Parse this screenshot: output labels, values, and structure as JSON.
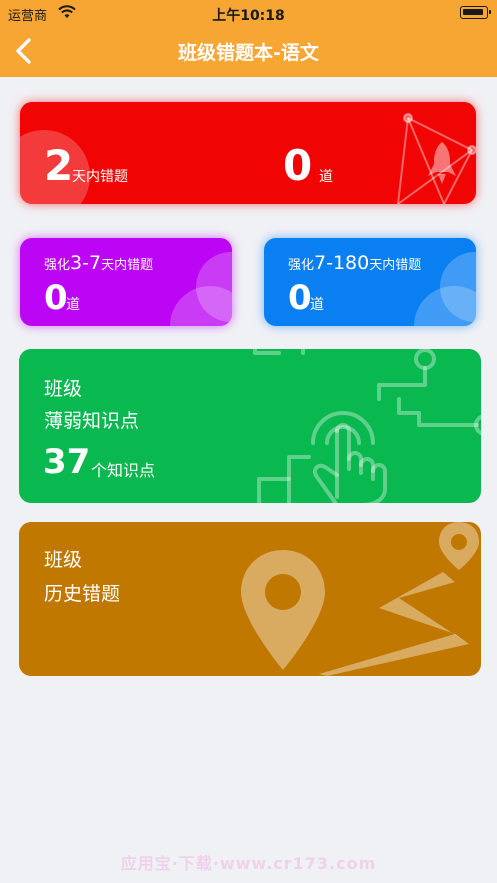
{
  "status_bar": {
    "carrier": "运营商",
    "time": "上午10:18"
  },
  "nav": {
    "title": "班级错题本-语文"
  },
  "recent_card": {
    "days": "2",
    "days_label": "天内错题",
    "count": "0",
    "count_unit": "道"
  },
  "reinforce_3_7": {
    "prefix": "强化",
    "range": "3-7",
    "suffix": "天内错题",
    "count": "0",
    "count_unit": "道"
  },
  "reinforce_7_180": {
    "prefix": "强化",
    "range": "7-180",
    "suffix": "天内错题",
    "count": "0",
    "count_unit": "道"
  },
  "weak_points_card": {
    "line1": "班级",
    "line2": "薄弱知识点",
    "count": "37",
    "count_unit": "个知识点"
  },
  "history_card": {
    "line1": "班级",
    "line2": "历史错题"
  },
  "watermark": "应用宝·下载·www.cr173.com",
  "colors": {
    "header": "#f7a533",
    "red_card": "#f10404",
    "purple_card": "#bb05f4",
    "blue_card": "#0a7ff2",
    "green_card": "#0ab850",
    "brown_card": "#c07800",
    "background": "#f0f1f5"
  },
  "icons": [
    "wifi-icon",
    "battery-icon",
    "back-chevron-icon",
    "rocket-icon",
    "hand-pointer-icon",
    "map-pin-icon"
  ]
}
